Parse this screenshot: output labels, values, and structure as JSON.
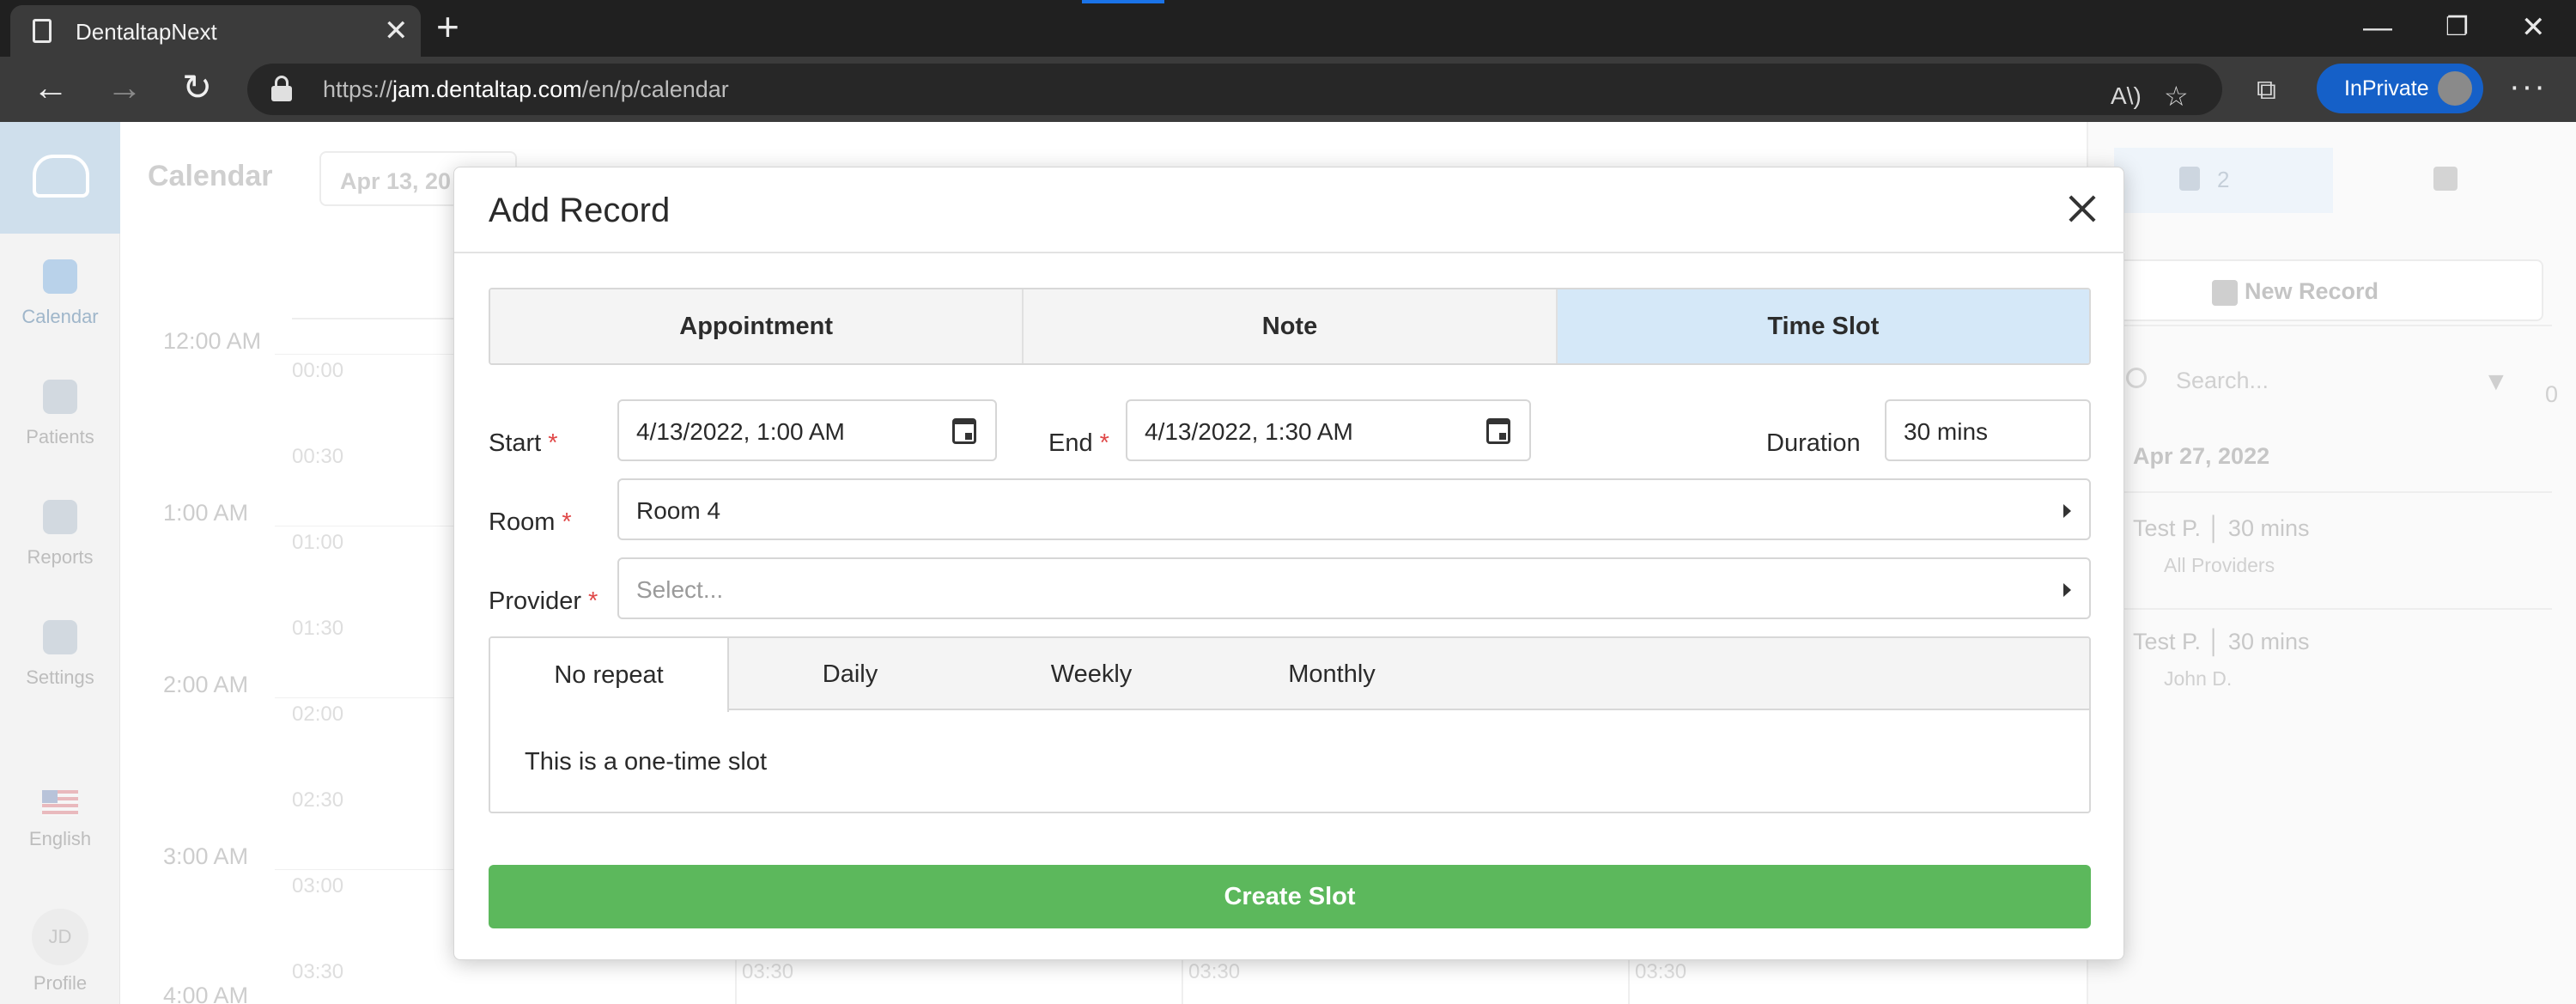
{
  "browser": {
    "tab_title": "DentaltapNext",
    "url_prefix": "https://",
    "url_host": "jam.dentaltap.com",
    "url_path": "/en/p/calendar",
    "inprivate_label": "InPrivate"
  },
  "sidebar": {
    "items": [
      {
        "label": "Calendar",
        "icon": "calendar-icon",
        "active": true
      },
      {
        "label": "Patients",
        "icon": "patients-icon",
        "active": false
      },
      {
        "label": "Reports",
        "icon": "reports-icon",
        "active": false
      },
      {
        "label": "Settings",
        "icon": "gear-icon",
        "active": false
      }
    ],
    "language_label": "English",
    "profile_initials": "JD",
    "profile_label": "Profile"
  },
  "calendar": {
    "title": "Calendar",
    "date_chip": "Apr 13, 20",
    "hour_labels": [
      "12:00 AM",
      "1:00 AM",
      "2:00 AM",
      "3:00 AM",
      "4:00 AM"
    ],
    "slot_labels": [
      "00:00",
      "00:30",
      "01:00",
      "01:30",
      "02:00",
      "02:30",
      "03:00",
      "03:30"
    ],
    "column_slot_label": "03:30"
  },
  "right_panel": {
    "tab_count": "2",
    "new_record_label": "New Record",
    "search_placeholder": "Search...",
    "filter_count": "0",
    "date_header": "Apr 27, 2022",
    "records": [
      {
        "title": "Test P. │ 30 mins",
        "subtitle": "All Providers"
      },
      {
        "title": "Test P. │ 30 mins",
        "subtitle": "John D."
      }
    ]
  },
  "modal": {
    "title": "Add Record",
    "type_tabs": [
      {
        "label": "Appointment",
        "active": false
      },
      {
        "label": "Note",
        "active": false
      },
      {
        "label": "Time Slot",
        "active": true
      }
    ],
    "start_label": "Start",
    "start_value": "4/13/2022, 1:00 AM",
    "end_label": "End",
    "end_value": "4/13/2022, 1:30 AM",
    "duration_label": "Duration",
    "duration_value": "30 mins",
    "room_label": "Room",
    "room_value": "Room 4",
    "provider_label": "Provider",
    "provider_placeholder": "Select...",
    "repeat_tabs": [
      {
        "label": "No repeat",
        "active": true
      },
      {
        "label": "Daily",
        "active": false
      },
      {
        "label": "Weekly",
        "active": false
      },
      {
        "label": "Monthly",
        "active": false
      }
    ],
    "repeat_description": "This is a one-time slot",
    "submit_label": "Create Slot"
  },
  "colors": {
    "accent_green": "#5cb85c",
    "active_tab_blue": "#d5e8f8",
    "required_red": "#e04848",
    "inprivate_blue": "#1560c8"
  }
}
